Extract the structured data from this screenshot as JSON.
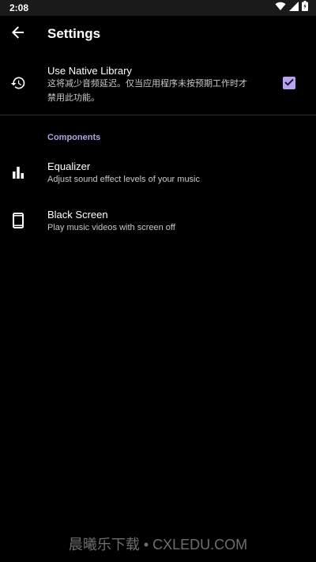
{
  "status_bar": {
    "time": "2:08",
    "icons": [
      "wifi-icon",
      "signal-icon",
      "battery-icon"
    ]
  },
  "toolbar": {
    "title": "Settings",
    "back_icon": "arrow-back-icon"
  },
  "native_library": {
    "title": "Use Native Library",
    "summary_line1": "这将减少音频延迟。仅当应用程序未按预期工作时才",
    "summary_line2": "禁用此功能。",
    "checked": true,
    "icon": "history-icon"
  },
  "components": {
    "header": "Components",
    "items": [
      {
        "title": "Equalizer",
        "summary": "Adjust sound effect levels of your music",
        "icon": "equalizer-icon"
      },
      {
        "title": "Black Screen",
        "summary": "Play music videos with screen off",
        "icon": "phone-icon"
      }
    ]
  },
  "watermark": "晨曦乐下载 • CXLEDU.COM",
  "colors": {
    "background": "#000000",
    "accent": "#b9a3f0",
    "category": "#b3a1e6",
    "text_secondary": "#c8c8c8",
    "status_bar": "#1a1a1a"
  }
}
